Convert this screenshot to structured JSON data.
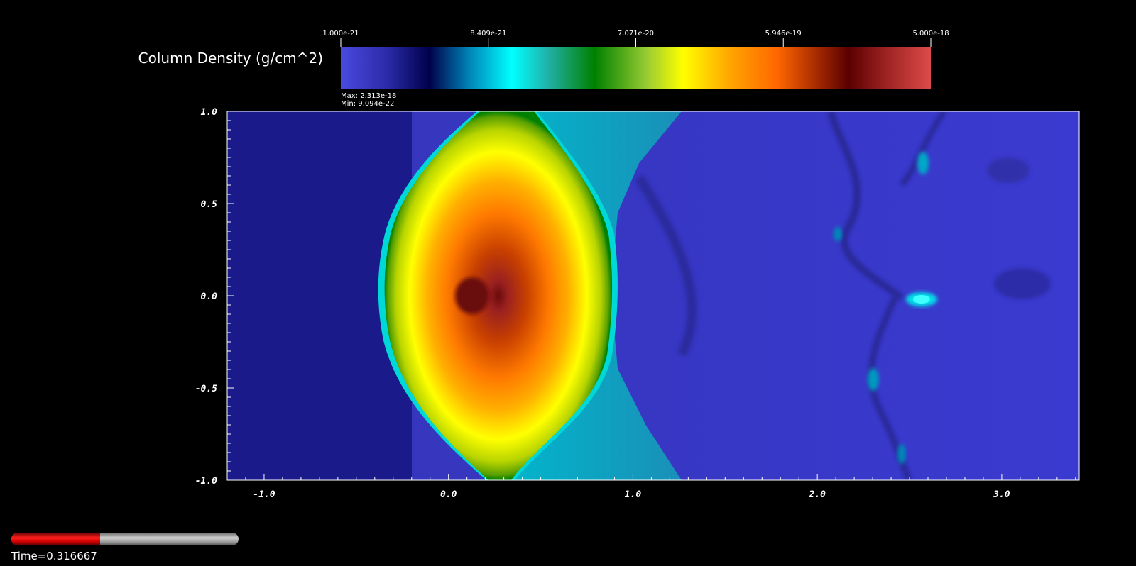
{
  "colorbar": {
    "title": "Column Density (g/cm^2)",
    "tick_labels": [
      "1.000e-21",
      "8.409e-21",
      "7.071e-20",
      "5.946e-19",
      "5.000e-18"
    ],
    "tick_values": [
      1e-21,
      8.409e-21,
      7.071e-20,
      5.946e-19,
      5e-18
    ],
    "scale": "log",
    "max_text": "Max:  2.313e-18",
    "min_text": "Min:  9.094e-22",
    "colors": [
      [
        "#4a4ae0",
        0.0
      ],
      [
        "#2a2aa8",
        0.08
      ],
      [
        "#00004a",
        0.15
      ],
      [
        "#0088bb",
        0.22
      ],
      [
        "#00ffff",
        0.29
      ],
      [
        "#20b2aa",
        0.35
      ],
      [
        "#008000",
        0.43
      ],
      [
        "#9acd32",
        0.52
      ],
      [
        "#ffff00",
        0.58
      ],
      [
        "#ffa500",
        0.66
      ],
      [
        "#ff6600",
        0.74
      ],
      [
        "#b03000",
        0.8
      ],
      [
        "#5a0000",
        0.86
      ],
      [
        "#992020",
        0.92
      ],
      [
        "#dd4a4a",
        1.0
      ]
    ]
  },
  "chart_data": {
    "type": "heatmap",
    "title": "",
    "xlabel": "",
    "ylabel": "",
    "xlim": [
      -1.2,
      3.42
    ],
    "ylim": [
      -1.0,
      1.0
    ],
    "x_ticks": [
      "-1.0",
      "0.0",
      "1.0",
      "2.0",
      "3.0"
    ],
    "x_tick_values": [
      -1.0,
      0.0,
      1.0,
      2.0,
      3.0
    ],
    "y_ticks": [
      "1.0",
      "0.5",
      "0.0",
      "-0.5",
      "-1.0"
    ],
    "y_tick_values": [
      1.0,
      0.5,
      0.0,
      -0.5,
      -1.0
    ],
    "value_range": [
      9.094e-22,
      2.313e-18
    ],
    "features": [
      {
        "name": "dense clump core",
        "x": 0.14,
        "y": 0.0
      },
      {
        "name": "small filament knot",
        "x": 2.55,
        "y": 0.0
      }
    ]
  },
  "time": {
    "label": "Time=0.316667",
    "progress": 0.39
  }
}
